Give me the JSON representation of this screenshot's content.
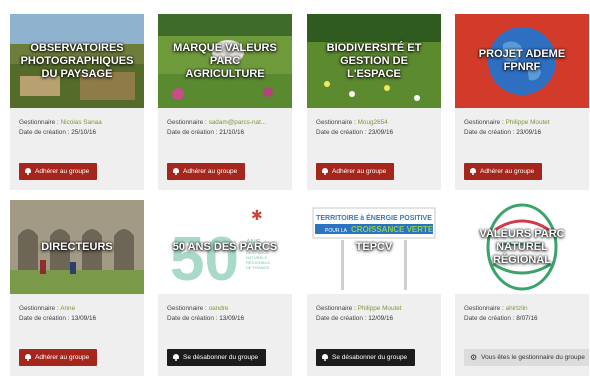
{
  "labels": {
    "manager": "Gestionnaire : ",
    "created": "Date de création : "
  },
  "cards": [
    {
      "title": "OBSERVATOIRES\nPHOTOGRAPHIQUES\nDU PAYSAGE",
      "manager": "Nicolas Sanaa",
      "date": "25/10/16",
      "button": "Adhérer au groupe",
      "button_style": "red",
      "icon": "bell-icon"
    },
    {
      "title": "MARQUE VALEURS\nPARC\nAGRICULTURE",
      "manager": "sadam@parcs-nat...",
      "date": "21/10/16",
      "button": "Adhérer au groupe",
      "button_style": "red",
      "icon": "bell-icon"
    },
    {
      "title": "BIODIVERSITÉ ET\nGESTION DE\nL'ESPACE",
      "manager": "Moug2654",
      "date": "23/09/16",
      "button": "Adhérer au groupe",
      "button_style": "red",
      "icon": "bell-icon"
    },
    {
      "title": "PROJET ADEME\nFPNRF",
      "manager": "Philippe Moutet",
      "date": "23/09/16",
      "button": "Adhérer au groupe",
      "button_style": "red",
      "icon": "bell-icon"
    },
    {
      "title": "DIRECTEURS",
      "manager": "Anne",
      "date": "13/09/16",
      "button": "Adhérer au groupe",
      "button_style": "red",
      "icon": "bell-icon"
    },
    {
      "title": "50 ANS DES PARCS",
      "manager": "oandre",
      "date": "13/09/16",
      "button": "Se désabonner du groupe",
      "button_style": "black",
      "icon": "bell-icon",
      "logo_text": {
        "big": "50",
        "ans": "ANS",
        "sub": "DES PARCS\nNATURELS\nRÉGIONAUX\nDE FRANCE"
      }
    },
    {
      "title": "TEPCV",
      "manager": "Philippe Moutet",
      "date": "12/09/16",
      "button": "Se désabonner du groupe",
      "button_style": "black",
      "icon": "bell-icon",
      "logo_text": {
        "line1": "TERRITOIRE à ÉNERGIE POSITIVE",
        "line2a": "POUR LA ",
        "line2b": "CROISSANCE VERTE"
      }
    },
    {
      "title": "VALEURS PARC\nNATUREL\nRÉGIONAL",
      "manager": "ahirtzlin",
      "date": "8/07/16",
      "button": "Vous êtes le gestionnaire du groupe",
      "button_style": "grey",
      "icon": "gear-icon"
    }
  ],
  "colors": {
    "join_button": "#a5261c",
    "unsubscribe_button": "#1c1c1c",
    "manager_link": "#7a9a3a",
    "card_bg": "#efefef"
  }
}
